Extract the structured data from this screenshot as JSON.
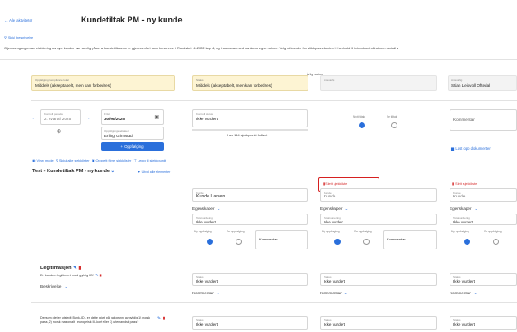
{
  "header": {
    "back_link": "Alle aktiviteter",
    "title": "Kundetiltak PM - ny kunde",
    "hide_description": "Skjul beskrivelse",
    "description": "Gjennomgangen av etablering av nye kunder bør særlig påse at kundetiltakene er gjennomført som beskrevet i Rundskriv 4-2022 kap 4, og i samsvar med bankens egne rutiner. Velg ut kunder for stikkprøvekontroll i henhold til internkontrollrutinen. Antall s"
  },
  "status_row": {
    "annual_status_title": "Årlig status",
    "comp_label": "Oppfølging compliance lokal",
    "comp_value": "Middels (akseptabelt, men kan forbedres)",
    "status_label": "Status",
    "status_value": "Middels (akseptabelt, men kan forbedres)",
    "right_label": "Ansvarlig",
    "right_value": "",
    "responsible_label": "Ansvarlig",
    "responsible_value": "Stian Leikvoll Oftedal"
  },
  "control": {
    "period_label": "Kontroll periode",
    "period_value": "2. kvartal 2025",
    "date_label": "Frist",
    "date_value": "30/06/2025",
    "responsible_label": "Oppfølgingsdeltaker",
    "responsible_value": "Erling Grimstad",
    "followup_button": "+ Oppfølging",
    "status_label": "Kontroll status",
    "status_value": "Ikke vurdert",
    "progress_text": "0 av 144 sjekkpunkt fullført",
    "new_measure": "Nytt tiltak",
    "see_measure": "Se tiltak",
    "comment_placeholder": "Kommentar",
    "upload_docs": "Last opp dokumenter"
  },
  "toolbar": {
    "view_mode": "View mode",
    "hide_all": "Skjul alle sjekklister",
    "create_more": "Opprett flere sjekklister",
    "add_checkpoint": "Legg til sjekkpunkt"
  },
  "checklist": {
    "title": "Test - Kundetiltak PM - ny kunde",
    "expand_all": "Utvid alle elementer",
    "delete_checklist": "Slett sjekkliste",
    "columns": [
      {
        "customer_label": "Kunde",
        "customer_value": "Kunde Larsen",
        "egenskaper": "Egenskaper",
        "total_label": "Totalvurdering",
        "total_value": "Ikke vurdert",
        "new_followup": "Ny oppfølging",
        "see_followup": "Se oppfølging",
        "comment": "Kommentar"
      },
      {
        "customer_label": "Kunde",
        "customer_value": "Kunde",
        "egenskaper": "Egenskaper",
        "total_label": "Totalvurdering",
        "total_value": "Ikke vurdert",
        "new_followup": "Ny oppfølging",
        "see_followup": "Se oppfølging",
        "comment": "Kommentar"
      },
      {
        "customer_label": "Kunde",
        "customer_value": "Kunde",
        "egenskaper": "Egenskaper",
        "total_label": "Totalvurdering",
        "total_value": "Ikke vurdert",
        "new_followup": "Ny oppfølging",
        "see_followup": "Se oppfølging",
        "comment": ""
      }
    ]
  },
  "checkpoints": [
    {
      "title": "Legitimasjon",
      "question": "Er kunden legitimert med gyldig ID?",
      "describe": "Beskrivelse",
      "status_label": "Status",
      "status_value": "Ikke vurdert",
      "comment": "Kommentar"
    },
    {
      "title": "",
      "question": "Dersom det er utstedt Bank-ID - er dette gjort på bakgrunn av gyldig 1) norsk pass, 2) norsk nasjonalt / europeisk ID-kort eller 3) utenlandsk pass?",
      "describe": "",
      "status_label": "Status",
      "status_value": "Ikke vurdert",
      "comment": ""
    }
  ],
  "colors": {
    "accent": "#2a6fdb",
    "danger": "#d62020",
    "highlight_yellow": "#fdf4d3"
  }
}
